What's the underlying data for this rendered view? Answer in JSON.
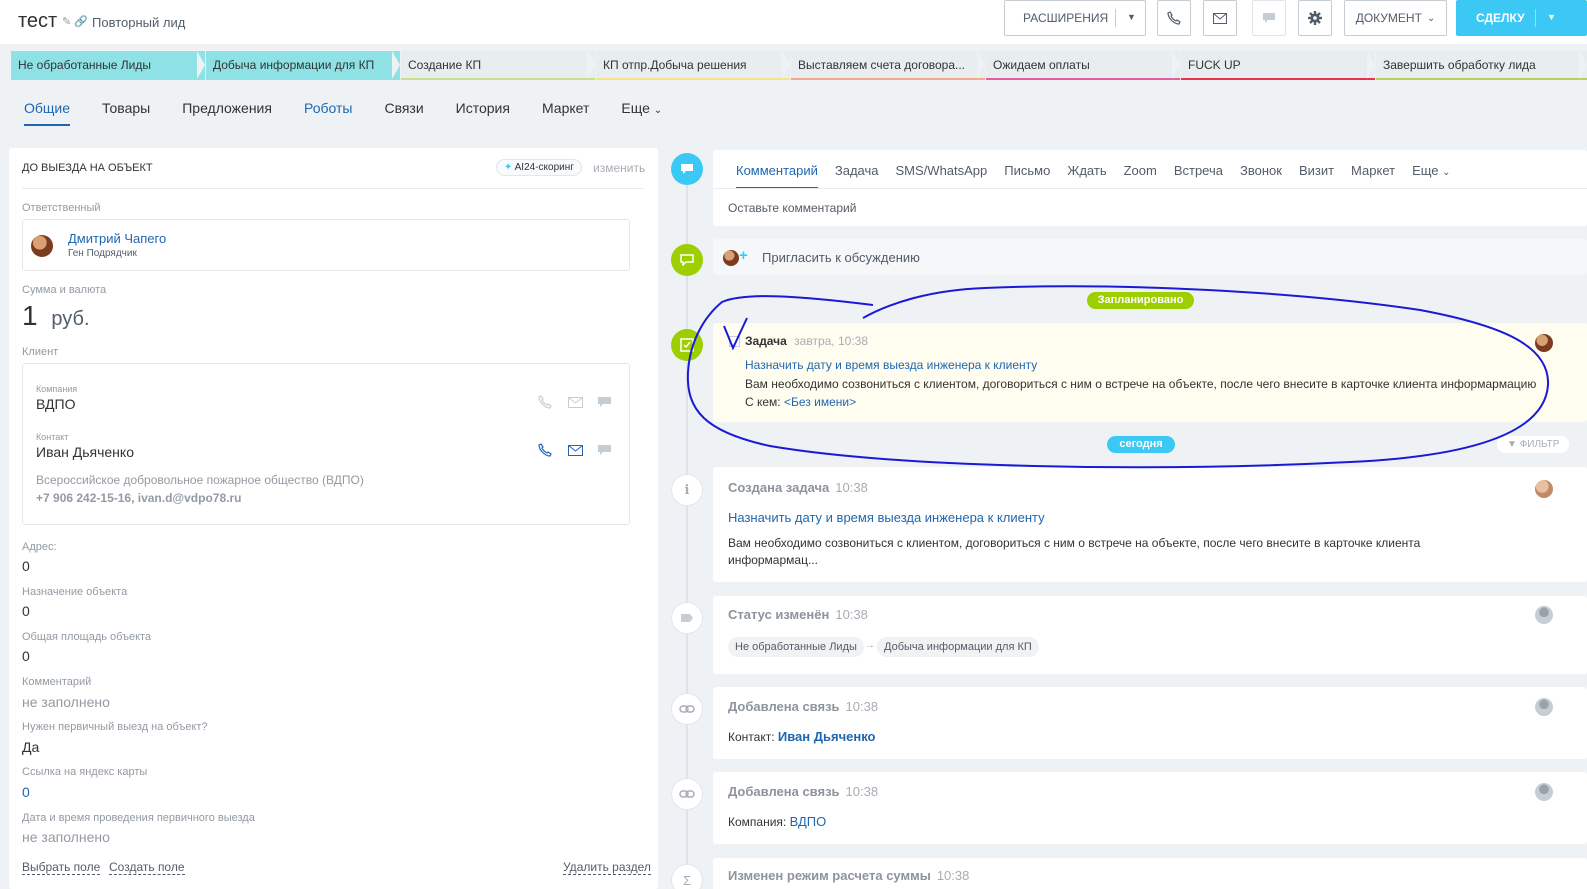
{
  "header": {
    "title": "тест",
    "subtitle": "Повторный лид",
    "buttons": {
      "extensions": "РАСШИРЕНИЯ",
      "document": "ДОКУМЕНТ",
      "deal": "СДЕЛКУ"
    }
  },
  "stages": [
    {
      "label": "Не обработанные Лиды",
      "color": "#8ee1e4"
    },
    {
      "label": "Добыча информации для КП",
      "color": "#8ee1e4"
    },
    {
      "label": "Создание КП",
      "color": "#e8edf0",
      "underline": "#c6e08c"
    },
    {
      "label": "КП отпр.Добыча решения",
      "color": "#e8edf0",
      "underline": "#f5e38a"
    },
    {
      "label": "Выставляем счета договора...",
      "color": "#e8edf0",
      "underline": "#f3a88c"
    },
    {
      "label": "Ожидаем оплаты",
      "color": "#e8edf0",
      "underline": "#e85aa2"
    },
    {
      "label": "FUCK UP",
      "color": "#e8edf0",
      "underline": "#e8334b"
    },
    {
      "label": "Завершить обработку лида",
      "color": "#e8edf0",
      "underline": "#b9cf5b"
    }
  ],
  "tabs": [
    "Общие",
    "Товары",
    "Предложения",
    "Роботы",
    "Связи",
    "История",
    "Маркет",
    "Еще"
  ],
  "left": {
    "section_title": "ДО ВЫЕЗДА НА ОБЪЕКТ",
    "scoring": "AI24-скоринг",
    "change": "изменить",
    "responsible_label": "Ответственный",
    "responsible_name": "Дмитрий Чапего",
    "responsible_role": "Ген Подрядчик",
    "sum_label": "Сумма и валюта",
    "sum_value": "1",
    "sum_currency": "руб.",
    "client_label": "Клиент",
    "company_label": "Компания",
    "company_name": "ВДПО",
    "contact_label": "Контакт",
    "contact_name": "Иван Дьяченко",
    "contact_org": "Всероссийское добровольное пожарное общество (ВДПО)",
    "contact_details": "+7 906 242-15-16, ivan.d@vdpo78.ru",
    "fields": [
      {
        "label": "Адрес:",
        "value": "0"
      },
      {
        "label": "Назначение объекта",
        "value": "0"
      },
      {
        "label": "Общая площадь объекта",
        "value": "0"
      },
      {
        "label": "Комментарий",
        "value": "не заполнено"
      },
      {
        "label": "Нужен первичный выезд на объект?",
        "value": "Да"
      },
      {
        "label": "Ссылка на яндекс карты",
        "value": "0"
      },
      {
        "label": "Дата и время проведения первичного выезда",
        "value": "не заполнено"
      }
    ],
    "choose_field": "Выбрать поле",
    "create_field": "Создать поле",
    "delete_section": "Удалить раздел"
  },
  "activity_tabs": [
    "Комментарий",
    "Задача",
    "SMS/WhatsApp",
    "Письмо",
    "Ждать",
    "Zoom",
    "Встреча",
    "Звонок",
    "Визит",
    "Маркет",
    "Еще"
  ],
  "comment_placeholder": "Оставьте комментарий",
  "invite": "Пригласить к обсуждению",
  "badges": {
    "planned": "Запланировано",
    "today": "сегодня",
    "filter": "ФИЛЬТР"
  },
  "task": {
    "title": "Задача",
    "time": "завтра, 10:38",
    "subject": "Назначить дату и время выезда инженера к клиенту",
    "description": "Вам необходимо созвониться с клиентом, договориться с ним о встрече на объекте, после чего внесите в карточке клиента информармацию",
    "with_label": "С кем:",
    "with_value": "<Без имени>"
  },
  "events": {
    "created": {
      "title": "Создана задача",
      "time": "10:38",
      "subject": "Назначить дату и время выезда инженера к клиенту",
      "text": "Вам необходимо созвониться с клиентом, договориться с ним о встрече на объекте, после чего внесите в карточке клиента информармац..."
    },
    "status": {
      "title": "Статус изменён",
      "time": "10:38",
      "from": "Не обработанные Лиды",
      "to": "Добыча информации для КП"
    },
    "link1": {
      "title": "Добавлена связь",
      "time": "10:38",
      "label": "Контакт:",
      "value": "Иван Дьяченко"
    },
    "link2": {
      "title": "Добавлена связь",
      "time": "10:38",
      "label": "Компания:",
      "value": "ВДПО"
    },
    "mode": {
      "title": "Изменен режим расчета суммы",
      "time": "10:38"
    }
  },
  "colors": {
    "accent": "#2067b0",
    "cyan": "#3bc8f5",
    "green": "#9dcf00",
    "annotation": "#1a1ad6"
  }
}
